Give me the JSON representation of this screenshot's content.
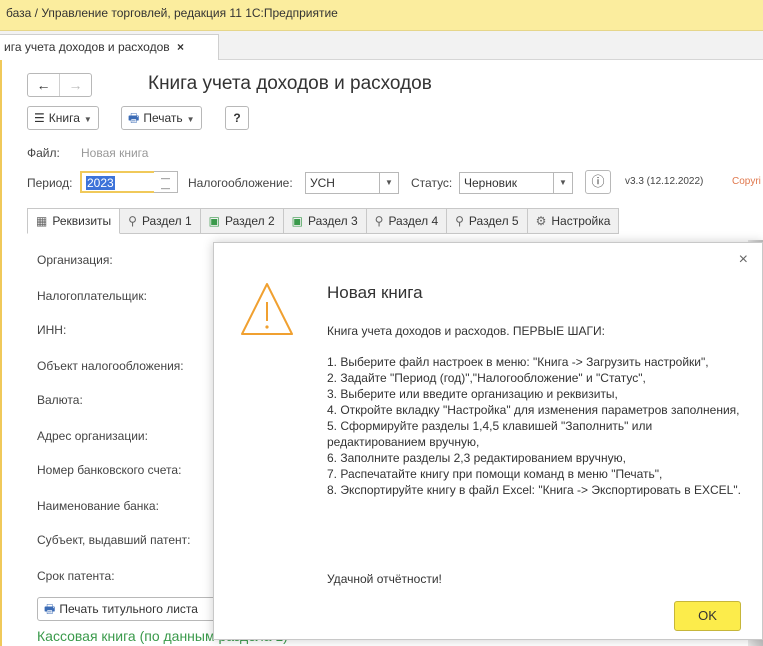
{
  "window": {
    "title": "база / Управление торговлей, редакция 11 1С:Предприятие"
  },
  "doc_tab": {
    "label": "ига учета доходов и расходов",
    "close": "×"
  },
  "form": {
    "title": "Книга учета доходов и расходов",
    "nav": {
      "back": "←",
      "forward": "→"
    },
    "toolbar": {
      "book_label": "Книга",
      "print_label": "Печать",
      "help_label": "?"
    },
    "file": {
      "label": "Файл:",
      "value": "Новая книга"
    },
    "period": {
      "label": "Период:",
      "value": "2023"
    },
    "taxation": {
      "label": "Налогообложение:",
      "value": "УСН"
    },
    "status": {
      "label": "Статус:",
      "value": "Черновик"
    },
    "version": "v3.3 (12.12.2022)",
    "copyright": "Copyri"
  },
  "tabs": [
    "Реквизиты",
    "Раздел 1",
    "Раздел 2",
    "Раздел 3",
    "Раздел 4",
    "Раздел 5",
    "Настройка"
  ],
  "fields": [
    "Организация:",
    "Налогоплательщик:",
    "ИНН:",
    "Объект налогообложения:",
    "Валюта:",
    "Адрес организации:",
    "Номер банковского счета:",
    "Наименование банка:",
    "Субъект, выдавший патент:",
    "Срок патента:"
  ],
  "print_title_button": "Печать титульного листа",
  "cash_book_link": "Кассовая книга (по данным раздела 1)",
  "dialog": {
    "title": "Новая книга",
    "subtitle": "Книга учета доходов и расходов. ПЕРВЫЕ ШАГИ:",
    "steps": [
      "1. Выберите файл настроек в меню: \"Книга -> Загрузить настройки\",",
      "2. Задайте \"Период (год)\",\"Налогообложение\" и \"Статус\",",
      "3. Выберите или введите организацию и реквизиты,",
      "4. Откройте вкладку \"Настройка\" для изменения параметров заполнения,",
      "5. Сформируйте разделы 1,4,5 клавишей \"Заполнить\" или редактированием вручную,",
      "6. Заполните разделы 2,3 редактированием вручную,",
      "7. Распечатайте книгу при помощи команд в меню \"Печать\",",
      "8. Экспортируйте книгу в файл Excel: \"Книга -> Экспортировать в EXCEL\"."
    ],
    "footer": "Удачной отчётности!",
    "ok_label": "OK",
    "close": "×"
  },
  "colors": {
    "accent_yellow": "#fcec4b",
    "title_bar": "#fbed9e",
    "warning": "#f0a030",
    "link_green": "#3a9a4b"
  }
}
